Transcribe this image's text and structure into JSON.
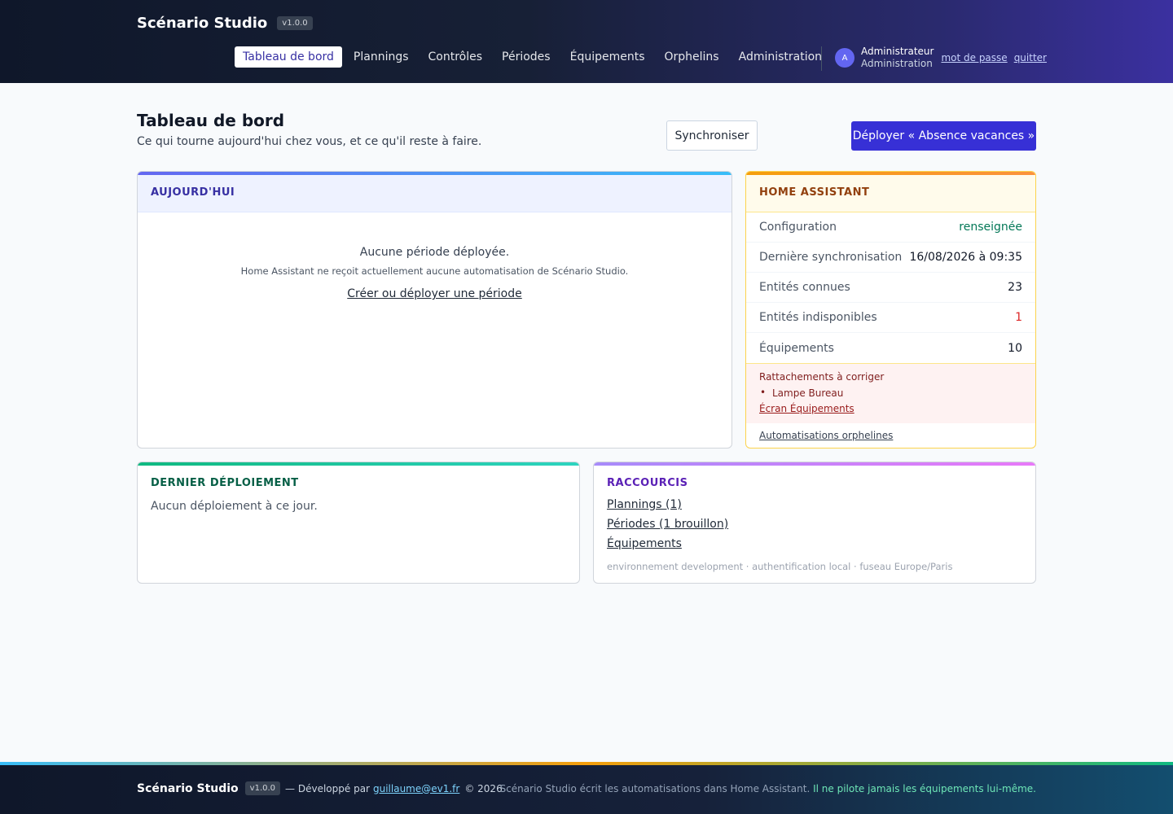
{
  "header": {
    "brand": "Scénario Studio",
    "version": "v1.0.0",
    "nav": [
      {
        "label": "Tableau de bord",
        "active": true
      },
      {
        "label": "Plannings"
      },
      {
        "label": "Contrôles"
      },
      {
        "label": "Périodes"
      },
      {
        "label": "Équipements"
      },
      {
        "label": "Orphelins"
      },
      {
        "label": "Administration"
      }
    ],
    "user": {
      "initial": "A",
      "name": "Administrateur",
      "role": "Administration",
      "password_link": "mot de passe",
      "logout_link": "quitter"
    }
  },
  "page": {
    "title": "Tableau de bord",
    "subtitle": "Ce qui tourne aujourd'hui chez vous, et ce qu'il reste à faire.",
    "sync_button": "Synchroniser",
    "deploy_button": "Déployer « Absence vacances »"
  },
  "today": {
    "title": "AUJOURD'HUI",
    "empty_title": "Aucune période déployée.",
    "empty_desc": "Home Assistant ne reçoit actuellement aucune automatisation de Scénario Studio.",
    "link": "Créer ou déployer une période"
  },
  "home_assistant": {
    "title": "HOME ASSISTANT",
    "rows": [
      {
        "label": "Configuration",
        "value": "renseignée"
      },
      {
        "label": "Dernière synchronisation",
        "value": "16/08/2026 à 09:35"
      },
      {
        "label": "Entités connues",
        "value": "23"
      },
      {
        "label": "Entités indisponibles",
        "value": "1"
      },
      {
        "label": "Équipements",
        "value": "10"
      }
    ],
    "alert_title": "Rattachements à corriger",
    "alert_item": "Lampe Bureau",
    "alert_link": "Écran Équipements",
    "orphans_link": "Automatisations orphelines"
  },
  "last_deployment": {
    "title": "DERNIER DÉPLOIEMENT",
    "empty": "Aucun déploiement à ce jour."
  },
  "shortcuts": {
    "title": "RACCOURCIS",
    "links": [
      "Plannings (1)",
      "Périodes (1 brouillon)",
      "Équipements"
    ],
    "meta": "environnement development · authentification local · fuseau Europe/Paris"
  },
  "footer": {
    "brand": "Scénario Studio",
    "version": "v1.0.0",
    "dev_prefix": "— Développé par",
    "dev_email": "guillaume@ev1.fr",
    "copyright": "© 2026",
    "notice_muted": "Scénario Studio écrit les automatisations dans Home Assistant.",
    "notice_accent": "Il ne pilote jamais les équipements lui-même."
  },
  "colors": {
    "primary": "#3730d6",
    "success": "#047857",
    "danger": "#dc2626"
  }
}
